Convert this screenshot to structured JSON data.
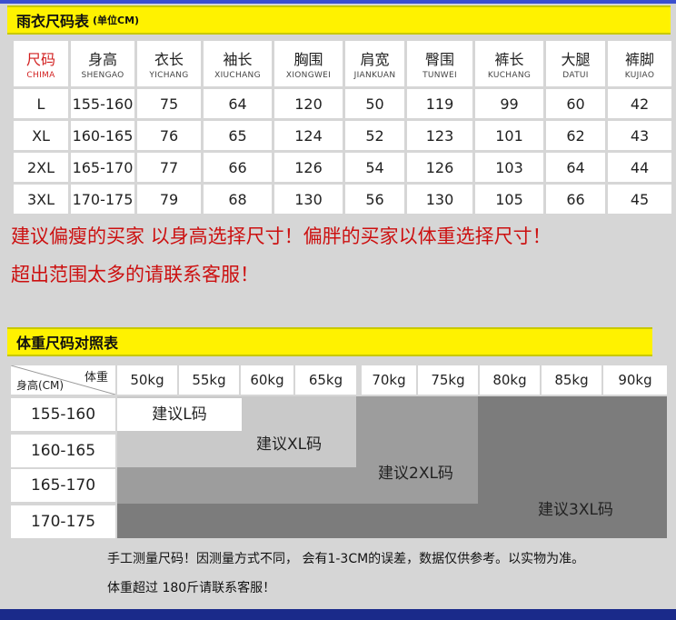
{
  "size_section": {
    "title": "雨衣尺码表",
    "subtitle": "(单位CM)",
    "headers": [
      {
        "cn": "尺码",
        "py": "CHIMA"
      },
      {
        "cn": "身高",
        "py": "SHENGAO"
      },
      {
        "cn": "衣长",
        "py": "YICHANG"
      },
      {
        "cn": "袖长",
        "py": "XIUCHANG"
      },
      {
        "cn": "胸围",
        "py": "XIONGWEI"
      },
      {
        "cn": "肩宽",
        "py": "JIANKUAN"
      },
      {
        "cn": "臀围",
        "py": "TUNWEI"
      },
      {
        "cn": "裤长",
        "py": "KUCHANG"
      },
      {
        "cn": "大腿",
        "py": "DATUI"
      },
      {
        "cn": "裤脚",
        "py": "KUJIAO"
      }
    ],
    "rows": [
      [
        "L",
        "155-160",
        "75",
        "64",
        "120",
        "50",
        "119",
        "99",
        "60",
        "42"
      ],
      [
        "XL",
        "160-165",
        "76",
        "65",
        "124",
        "52",
        "123",
        "101",
        "62",
        "43"
      ],
      [
        "2XL",
        "165-170",
        "77",
        "66",
        "126",
        "54",
        "126",
        "103",
        "64",
        "44"
      ],
      [
        "3XL",
        "170-175",
        "79",
        "68",
        "130",
        "56",
        "130",
        "105",
        "66",
        "45"
      ]
    ]
  },
  "notice": {
    "line1": "建议偏瘦的买家 以身高选择尺寸！偏胖的买家以体重选择尺寸！",
    "line2": "超出范围太多的请联系客服！"
  },
  "weight_section": {
    "title": "体重尺码对照表",
    "corner_weight": "体重",
    "corner_height": "身高(CM)",
    "weights": [
      "50kg",
      "55kg",
      "60kg",
      "65kg",
      "70kg",
      "75kg",
      "80kg",
      "85kg",
      "90kg"
    ],
    "heights": [
      "155-160",
      "160-165",
      "165-170",
      "170-175"
    ],
    "suggestions": [
      "建议L码",
      "建议XL码",
      "建议2XL码",
      "建议3XL码"
    ]
  },
  "footer": {
    "line1": "手工测量尺码！因测量方式不同， 会有1-3CM的误差，数据仅供参考。以实物为准。",
    "line2": "体重超过 180斤请联系客服！"
  },
  "colors": {
    "accent_yellow": "#fff200",
    "notice_red": "#cc1010",
    "band_blue": "#1a2a8a",
    "zone_xl": "#c9c9c9",
    "zone_2xl": "#9d9d9d",
    "zone_3xl": "#7c7c7c"
  }
}
